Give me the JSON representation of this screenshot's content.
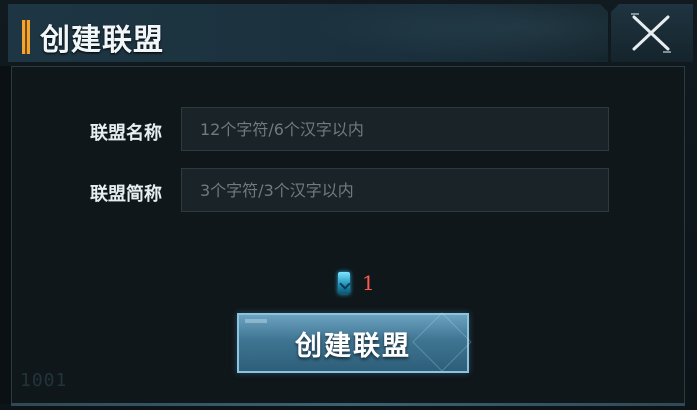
{
  "dialog": {
    "title": "创建联盟",
    "close_icon": "close-x-icon"
  },
  "form": {
    "name_label": "联盟名称",
    "name_placeholder": "12个字符/6个汉字以内",
    "name_value": "",
    "short_label": "联盟简称",
    "short_placeholder": "3个字符/3个汉字以内",
    "short_value": ""
  },
  "cost": {
    "currency_icon": "diamond-gem-icon",
    "amount": "1",
    "amount_color": "#ff5a4e"
  },
  "actions": {
    "create_label": "创建联盟"
  },
  "decor": {
    "watermark": "1001"
  },
  "colors": {
    "accent_orange": "#f2a531",
    "header_bg": "#1e3644",
    "button_blue": "#3f7592"
  }
}
